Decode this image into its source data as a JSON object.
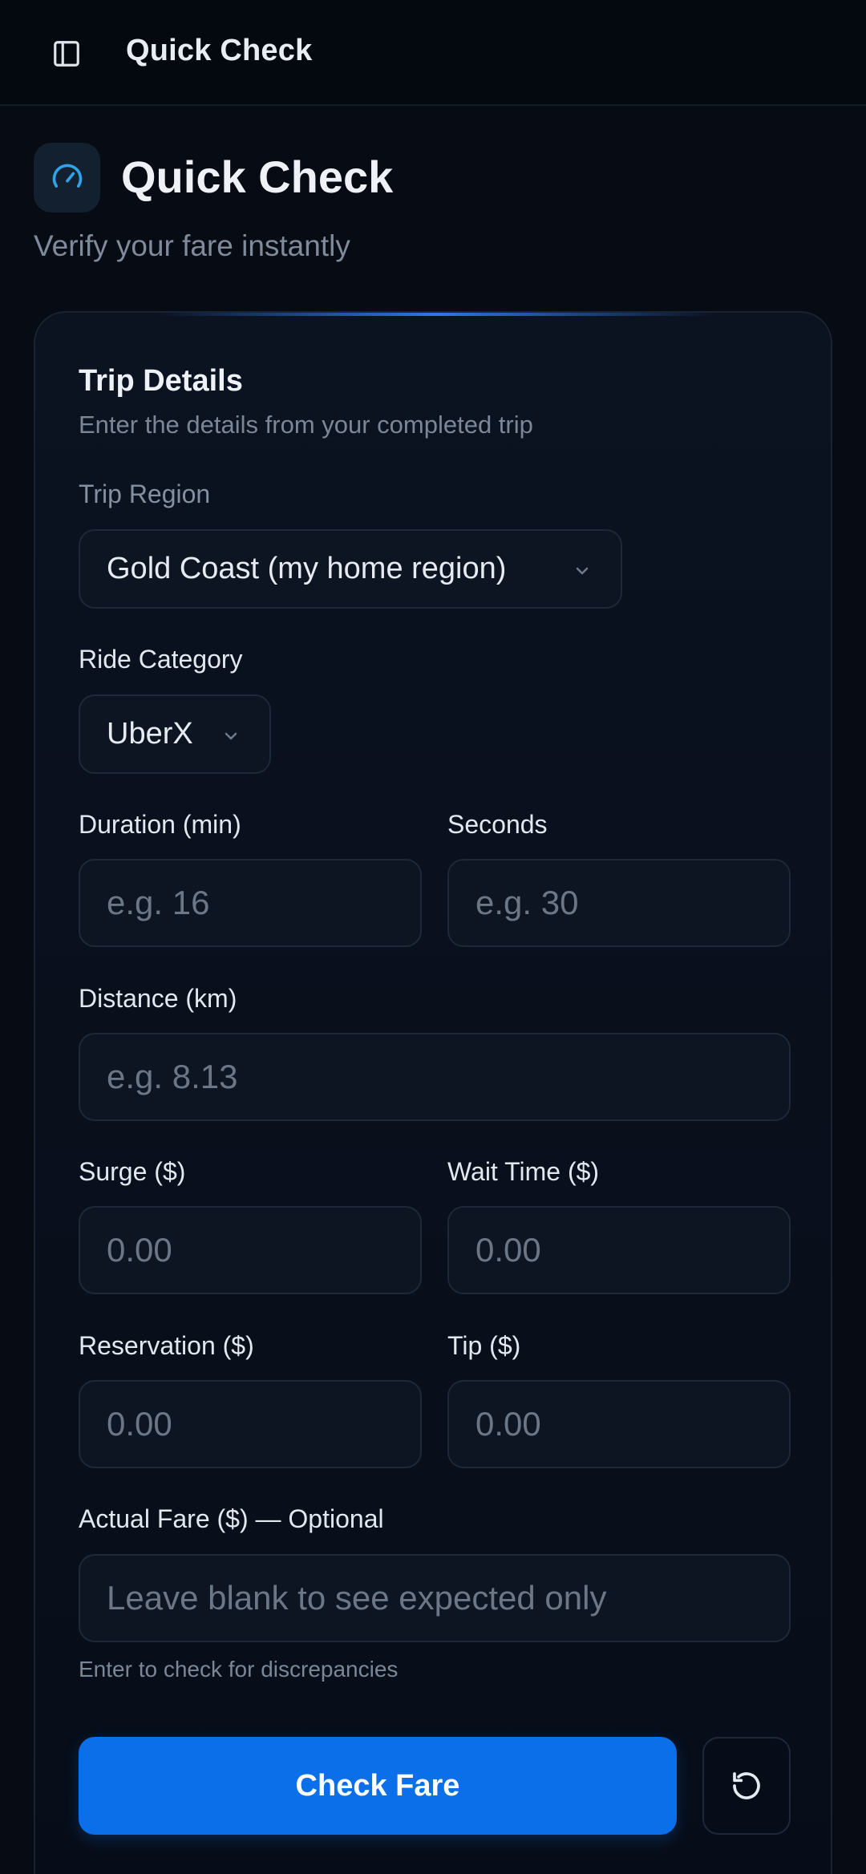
{
  "topbar": {
    "title": "Quick Check",
    "toggle_icon": "sidebar-toggle-icon"
  },
  "header": {
    "title": "Quick Check",
    "subtitle": "Verify your fare instantly",
    "icon": "speedometer-icon"
  },
  "card": {
    "title": "Trip Details",
    "subtitle": "Enter the details from your completed trip",
    "region": {
      "label": "Trip Region",
      "value": "Gold Coast (my home region)"
    },
    "category": {
      "label": "Ride Category",
      "value": "UberX"
    },
    "duration": {
      "label": "Duration (min)",
      "placeholder": "e.g. 16"
    },
    "seconds": {
      "label": "Seconds",
      "placeholder": "e.g. 30"
    },
    "distance": {
      "label": "Distance (km)",
      "placeholder": "e.g. 8.13"
    },
    "surge": {
      "label": "Surge ($)",
      "placeholder": "0.00"
    },
    "wait": {
      "label": "Wait Time ($)",
      "placeholder": "0.00"
    },
    "reservation": {
      "label": "Reservation ($)",
      "placeholder": "0.00"
    },
    "tip": {
      "label": "Tip ($)",
      "placeholder": "0.00"
    },
    "actual": {
      "label": "Actual Fare ($) — Optional",
      "placeholder": "Leave blank to see expected only",
      "hint": "Enter to check for discrepancies"
    },
    "check_button": "Check Fare",
    "reset_icon": "reset-icon"
  },
  "colors": {
    "accent": "#0a6fe8",
    "background": "#060b14",
    "card": "#0b1220",
    "icon_accent": "#2fa3e8"
  }
}
